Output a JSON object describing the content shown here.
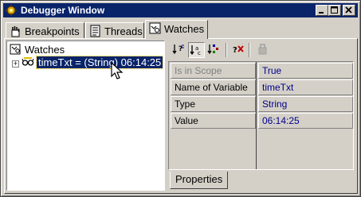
{
  "window": {
    "title": "Debugger Window",
    "controls": [
      "minimize",
      "maximize",
      "close"
    ]
  },
  "tabs": [
    {
      "label": "Breakpoints",
      "icon": "breakpoints-icon",
      "active": false
    },
    {
      "label": "Threads",
      "icon": "threads-icon",
      "active": false
    },
    {
      "label": "Watches",
      "icon": "watches-icon",
      "active": true
    }
  ],
  "tree": {
    "root_label": "Watches",
    "items": [
      {
        "label": "timeTxt = (String) 06:14:25",
        "selected": true,
        "expanded": false
      }
    ]
  },
  "properties": {
    "toolbar": [
      {
        "icon": "sort-by-category-icon",
        "pressed": false
      },
      {
        "icon": "sort-by-name-icon",
        "pressed": true
      },
      {
        "icon": "sort-by-type-icon",
        "pressed": false
      },
      {
        "icon": "remove-property-icon",
        "pressed": false
      },
      {
        "icon": "customizer-icon",
        "disabled": true
      }
    ],
    "rows": [
      {
        "name": "Is in Scope",
        "value": "True",
        "dim": true
      },
      {
        "name": "Name of Variable",
        "value": "timeTxt"
      },
      {
        "name": "Type",
        "value": "String"
      },
      {
        "name": "Value",
        "value": "06:14:25"
      }
    ],
    "bottom_tab": "Properties"
  },
  "colors": {
    "titlebar": "#0a246a",
    "selection": "#0a246a",
    "value_text": "#00008b",
    "chrome": "#d4d0c8"
  }
}
